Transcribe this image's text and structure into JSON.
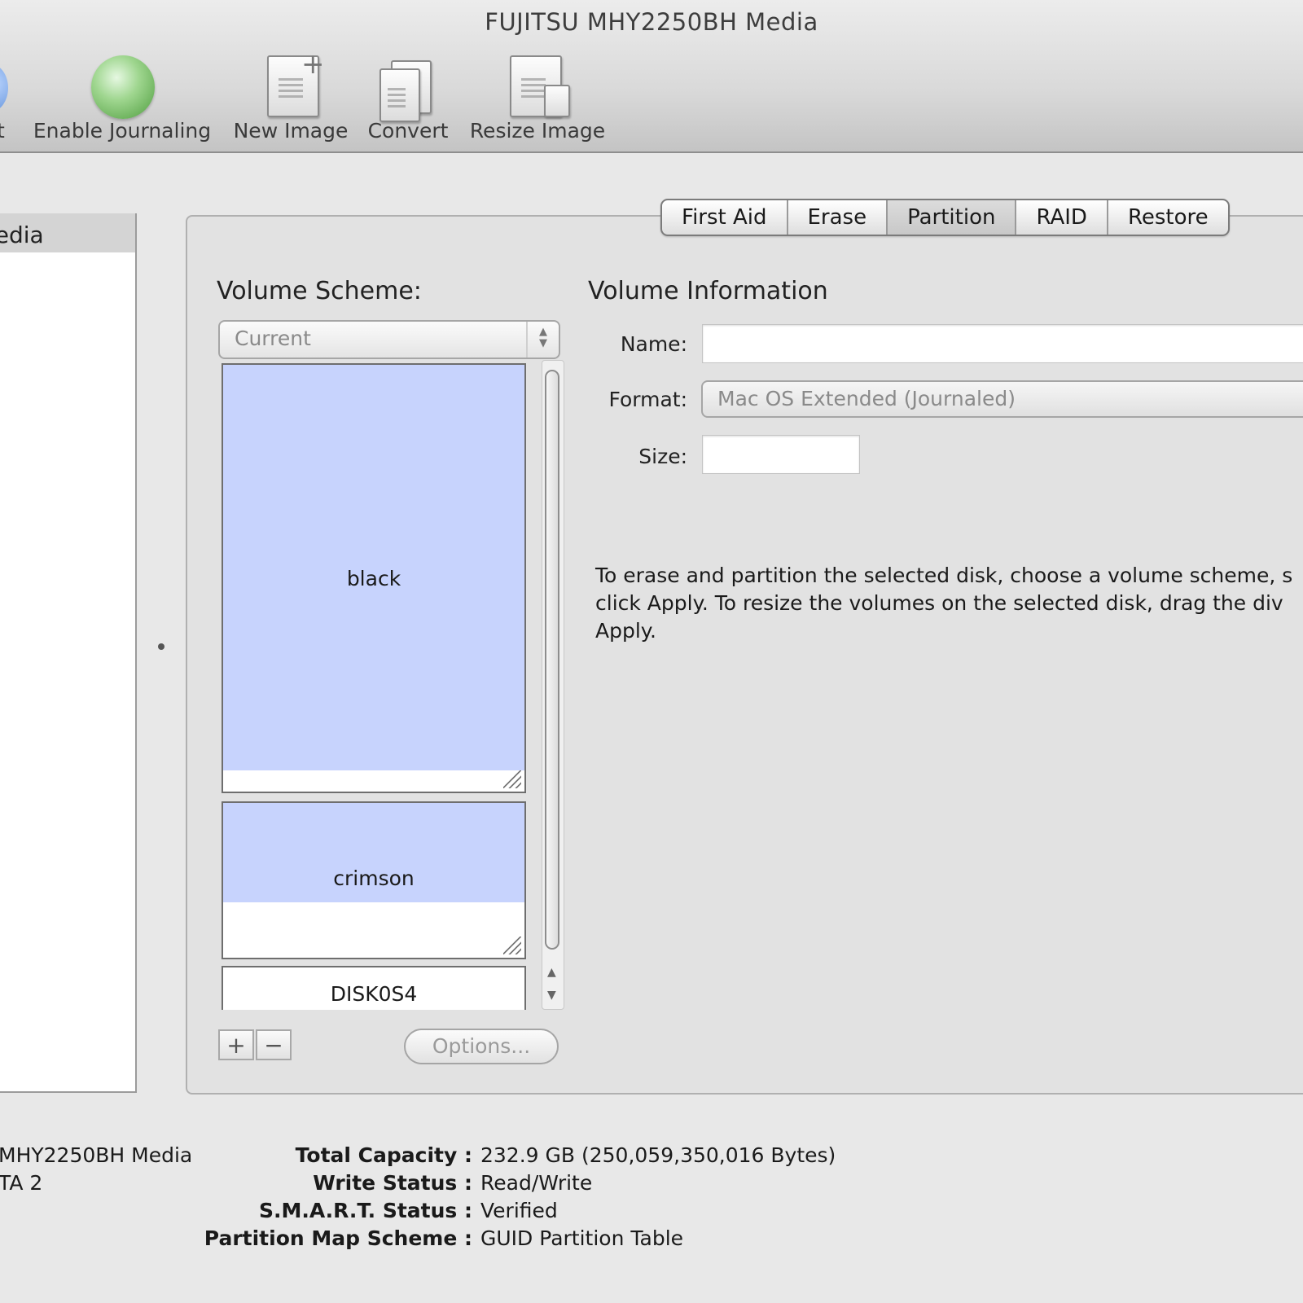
{
  "window": {
    "title": "FUJITSU MHY2250BH Media"
  },
  "toolbar": {
    "partial_left_label": "t",
    "items": [
      {
        "label": "Enable Journaling",
        "icon": "journal-globe-icon"
      },
      {
        "label": "New Image",
        "icon": "new-image-icon"
      },
      {
        "label": "Convert",
        "icon": "convert-icon"
      },
      {
        "label": "Resize Image",
        "icon": "resize-image-icon"
      }
    ]
  },
  "sidebar": {
    "selected_label": "ledia"
  },
  "tabs": [
    {
      "label": "First Aid",
      "active": false
    },
    {
      "label": "Erase",
      "active": false
    },
    {
      "label": "Partition",
      "active": true
    },
    {
      "label": "RAID",
      "active": false
    },
    {
      "label": "Restore",
      "active": false
    }
  ],
  "volume_scheme": {
    "heading": "Volume Scheme:",
    "popup_value": "Current",
    "partitions": [
      {
        "label": "black",
        "fill_color": "#c7d3fd"
      },
      {
        "label": "crimson",
        "fill_color": "#c7d3fd"
      },
      {
        "label": "DISK0S4",
        "fill_color": "#ffffff"
      }
    ],
    "add_button": "+",
    "remove_button": "−",
    "options_button": "Options..."
  },
  "volume_info": {
    "heading": "Volume Information",
    "name_label": "Name:",
    "name_value": "",
    "format_label": "Format:",
    "format_value": "Mac OS Extended (Journaled)",
    "size_label": "Size:",
    "size_value": "",
    "help_lines": [
      "To erase and partition the selected disk, choose a volume scheme, s",
      "click Apply. To resize the volumes on the selected disk, drag the div",
      "Apply."
    ]
  },
  "disk_info": {
    "left_lines": [
      " MHY2250BH Media",
      "TA 2"
    ],
    "rows": [
      {
        "key": "Total Capacity :",
        "value": "232.9 GB (250,059,350,016 Bytes)"
      },
      {
        "key": "Write Status :",
        "value": "Read/Write"
      },
      {
        "key": "S.M.A.R.T. Status :",
        "value": "Verified"
      },
      {
        "key": "Partition Map Scheme :",
        "value": "GUID Partition Table"
      }
    ]
  }
}
